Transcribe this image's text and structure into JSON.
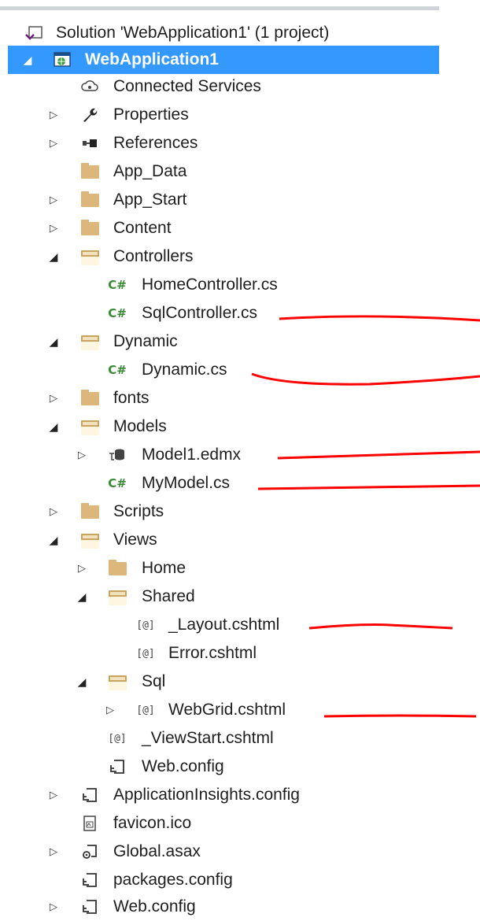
{
  "solution": {
    "label": "Solution 'WebApplication1' (1 project)"
  },
  "project": {
    "label": "WebApplication1"
  },
  "items": {
    "connected_services": "Connected Services",
    "properties": "Properties",
    "references": "References",
    "app_data": "App_Data",
    "app_start": "App_Start",
    "content": "Content",
    "controllers": "Controllers",
    "home_controller": "HomeController.cs",
    "sql_controller": "SqlController.cs",
    "dynamic": "Dynamic",
    "dynamic_cs": "Dynamic.cs",
    "fonts": "fonts",
    "models": "Models",
    "model1_edmx": "Model1.edmx",
    "mymodel_cs": "MyModel.cs",
    "scripts": "Scripts",
    "views": "Views",
    "home": "Home",
    "shared": "Shared",
    "layout_cshtml": "_Layout.cshtml",
    "error_cshtml": "Error.cshtml",
    "sql": "Sql",
    "webgrid_cshtml": "WebGrid.cshtml",
    "viewstart_cshtml": "_ViewStart.cshtml",
    "views_web_config": "Web.config",
    "appinsights_config": "ApplicationInsights.config",
    "favicon": "favicon.ico",
    "global_asax": "Global.asax",
    "packages_config": "packages.config",
    "web_config": "Web.config"
  },
  "glyphs": {
    "expanded": "◢",
    "collapsed": "▷",
    "csharp": "C#",
    "razor": "[@]"
  },
  "colors": {
    "selection": "#3399ff",
    "csharp_green": "#388a34",
    "folder": "#dcb67a",
    "annotation_red": "#ff0000"
  }
}
